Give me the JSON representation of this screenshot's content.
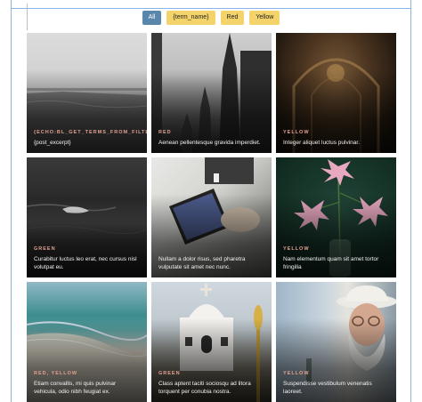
{
  "filters": [
    {
      "label": "All",
      "active": true
    },
    {
      "label": "{term_name}",
      "active": false
    },
    {
      "label": "Red",
      "active": false
    },
    {
      "label": "Yellow",
      "active": false
    }
  ],
  "cards": [
    {
      "category": "{ECHO:BL_GET_TERMS_FROM_FILTER_CATEGORIES}",
      "excerpt": "{post_excerpt}",
      "image": "seascape-photo"
    },
    {
      "category": "RED",
      "excerpt": "Aenean pellentesque gravida imperdiet.",
      "image": "cathedral-spires-photo"
    },
    {
      "category": "YELLOW",
      "excerpt": "Integer aliquet luctus pulvinar.",
      "image": "ornate-interior-photo"
    },
    {
      "category": "GREEN",
      "excerpt": "Curabitur luctus leo erat, nec cursus nisl volutpat eu.",
      "image": "ocean-wave-photo"
    },
    {
      "category": "",
      "excerpt": "Nullam a dolor risus, sed pharetra vulputate sit amet nec nunc.",
      "image": "tablet-drawing-photo"
    },
    {
      "category": "YELLOW",
      "excerpt": "Nam elementum quam sit amet tortor fringilla",
      "image": "lily-vase-photo"
    },
    {
      "category": "RED, YELLOW",
      "excerpt": "Etiam convallis, mi quis pulvinar vehicula, odio nibh feugiat ex.",
      "image": "beach-shore-photo"
    },
    {
      "category": "GREEN",
      "excerpt": "Class aptent taciti sociosqu ad litora torquent per conubia nostra.",
      "image": "white-chapel-photo"
    },
    {
      "category": "YELLOW",
      "excerpt": "Suspendisse vestibulum venenatis laoreet.",
      "image": "old-man-hat-photo"
    }
  ],
  "colors": {
    "active_filter": "#5b86ab",
    "filter": "#f3d36a",
    "category_text": "#e0a090",
    "guide": "#8ab4e8"
  }
}
